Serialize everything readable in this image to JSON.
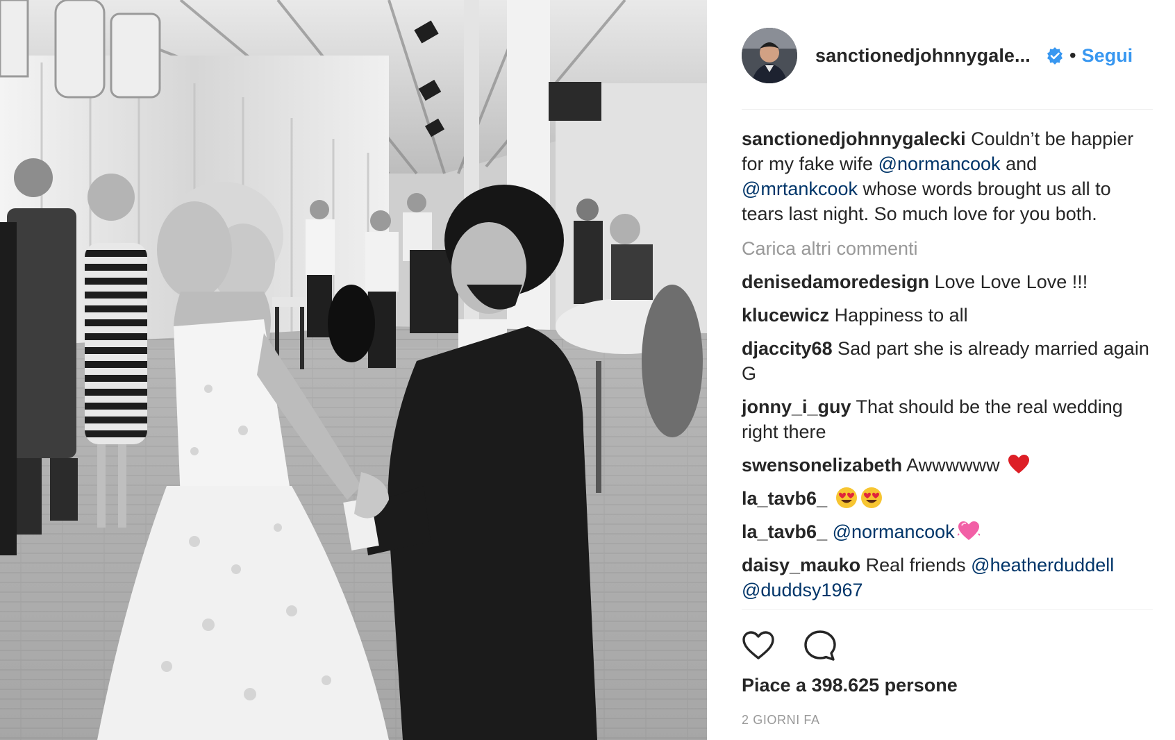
{
  "post": {
    "image_alt": "Black and white wedding photo",
    "author": {
      "username": "sanctionedjohnnygale...",
      "verified_icon": "verified-badge-icon",
      "follow_label": "Segui",
      "separator": "•"
    },
    "caption": {
      "username": "sanctionedjohnnygalecki",
      "text_1": " Couldn’t be happier for my fake wife ",
      "mention_1": "@normancook",
      "text_2": " and ",
      "mention_2": "@mrtankcook",
      "text_3": " whose words brought us all to tears last night. So much love for you both."
    },
    "load_more_label": "Carica altri commenti",
    "comments": [
      {
        "username": "denisedamoredesign",
        "text": " Love Love Love !!!"
      },
      {
        "username": "klucewicz",
        "text": " Happiness to all"
      },
      {
        "username": "djaccity68",
        "text": " Sad part she is already married again G"
      },
      {
        "username": "jonny_i_guy",
        "text": " That should be the real wedding right there"
      },
      {
        "username": "swensonelizabeth",
        "text": " Awwwwww ",
        "emoji": "red-heart-icon"
      },
      {
        "username": "la_tavb6_",
        "text": " ",
        "emoji": "heart-eyes-icon"
      },
      {
        "username": "la_tavb6_",
        "mention": "@normancook",
        "emoji": "pink-heart-icon"
      },
      {
        "username": "daisy_mauko",
        "text": " Real friends ",
        "mention_1": "@heatherduddell",
        "mention_2": "@duddsy1967"
      }
    ],
    "likes_label": "Piace a 398.625 persone",
    "timestamp": "2 GIORNI FA"
  },
  "colors": {
    "link_blue": "#3897f0",
    "mention_blue": "#003569",
    "text": "#262626",
    "muted": "#999999",
    "divider": "#efefef"
  }
}
